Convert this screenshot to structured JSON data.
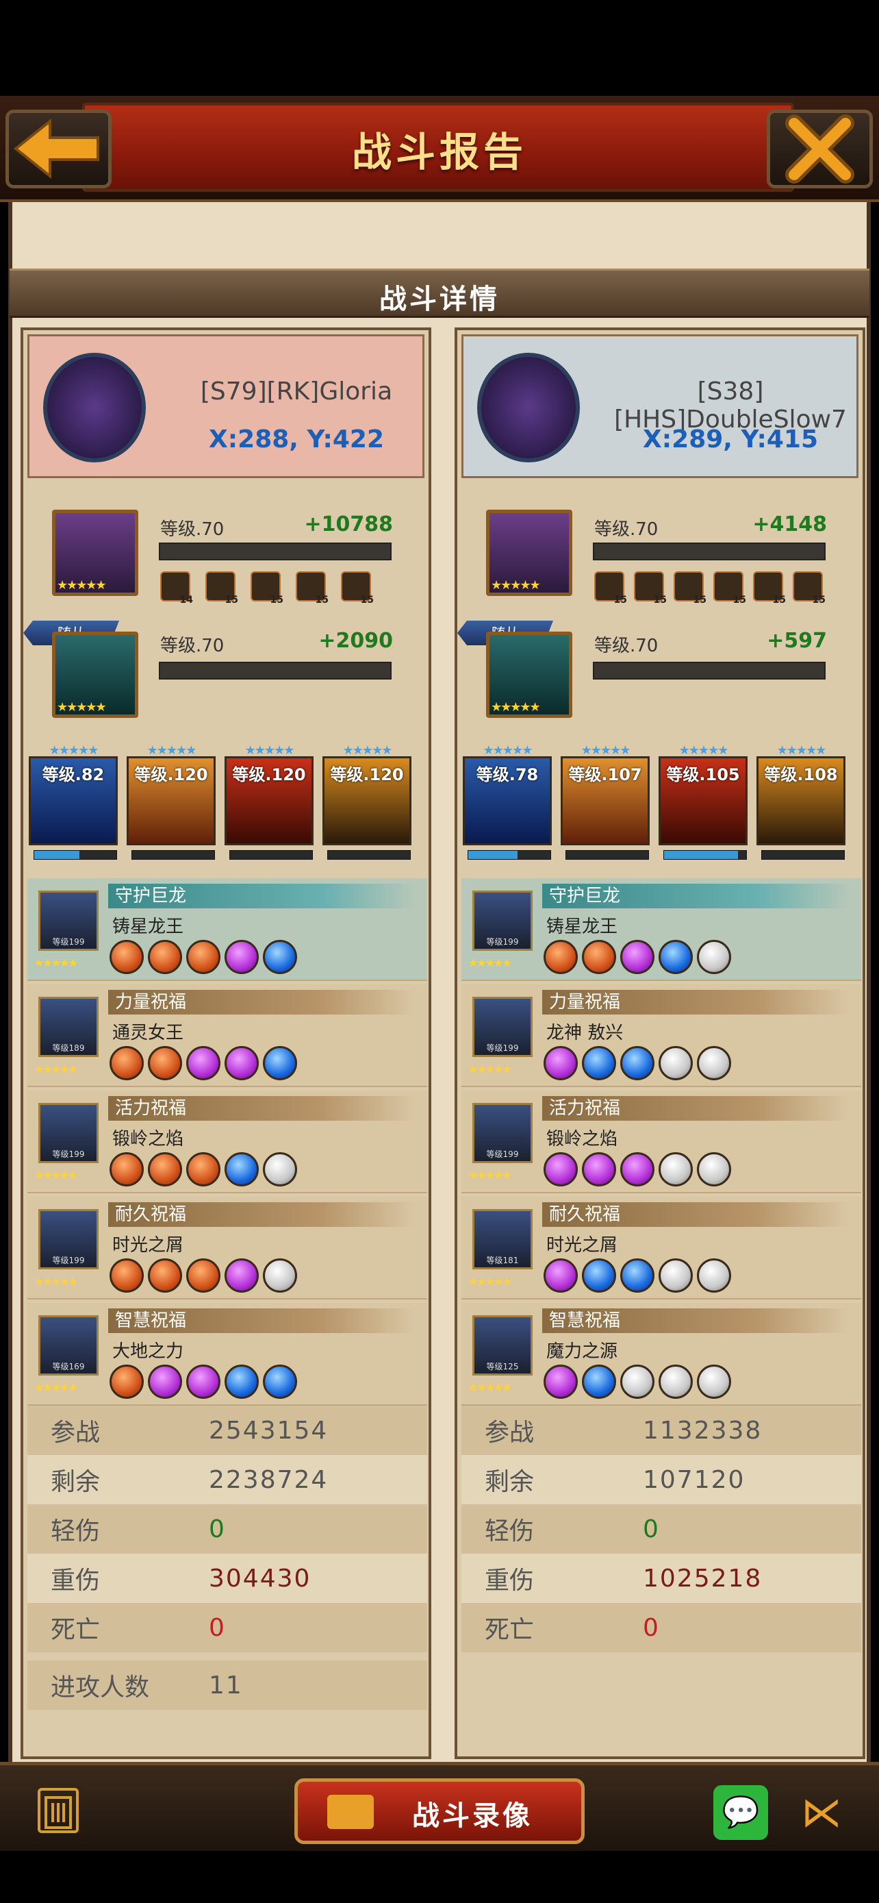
{
  "header": {
    "title": "战斗报告"
  },
  "section": {
    "title": "战斗详情"
  },
  "colors": {
    "left_card": "#e8b7a8",
    "right_card": "#ccd3d6",
    "green": "#1f7a1f",
    "blue": "#1b5fb8"
  },
  "players": [
    {
      "name": "[S79][RK]Gloria",
      "coords": "X:288, Y:422",
      "hero": {
        "level": "等级.70",
        "gain": "+10788",
        "gear": [
          "14",
          "15",
          "15",
          "15",
          "15"
        ]
      },
      "companion": {
        "tag": "随从",
        "level": "等级.70",
        "gain": "+2090"
      },
      "troops": [
        {
          "level": "等级.82",
          "exp_fill": 0.55
        },
        {
          "level": "等级.120",
          "exp_fill": 0.0
        },
        {
          "level": "等级.120",
          "exp_fill": 0.0
        },
        {
          "level": "等级.120",
          "exp_fill": 0.0
        }
      ],
      "dragons": [
        {
          "category": "守护巨龙",
          "name": "铸星龙王",
          "dlevel": "等级199",
          "orbs": [
            "orange",
            "orange",
            "orange",
            "purple",
            "blue"
          ]
        },
        {
          "category": "力量祝福",
          "name": "通灵女王",
          "dlevel": "等级189",
          "orbs": [
            "orange",
            "orange",
            "purple",
            "purple",
            "blue"
          ]
        },
        {
          "category": "活力祝福",
          "name": "锻岭之焰",
          "dlevel": "等级199",
          "orbs": [
            "orange",
            "orange",
            "orange",
            "blue",
            "grey"
          ]
        },
        {
          "category": "耐久祝福",
          "name": "时光之屑",
          "dlevel": "等级199",
          "orbs": [
            "orange",
            "orange",
            "orange",
            "purple",
            "grey"
          ]
        },
        {
          "category": "智慧祝福",
          "name": "大地之力",
          "dlevel": "等级169",
          "orbs": [
            "orange",
            "purple",
            "purple",
            "blue",
            "blue"
          ]
        }
      ],
      "stats": [
        {
          "label": "参战",
          "value": "2543154",
          "color": "#555"
        },
        {
          "label": "剩余",
          "value": "2238724",
          "color": "#555"
        },
        {
          "label": "轻伤",
          "value": "0",
          "color": "#1f7a1f"
        },
        {
          "label": "重伤",
          "value": "304430",
          "color": "#7a1a1a"
        },
        {
          "label": "死亡",
          "value": "0",
          "color": "#c02020"
        }
      ],
      "attackers": {
        "label": "进攻人数",
        "value": "11"
      }
    },
    {
      "name": "[S38][HHS]DoubleSlow7",
      "coords": "X:289, Y:415",
      "hero": {
        "level": "等级.70",
        "gain": "+4148",
        "gear": [
          "15",
          "15",
          "15",
          "15",
          "15",
          "15"
        ]
      },
      "companion": {
        "tag": "随从",
        "level": "等级.70",
        "gain": "+597"
      },
      "troops": [
        {
          "level": "等级.78",
          "exp_fill": 0.6
        },
        {
          "level": "等级.107",
          "exp_fill": 0.0
        },
        {
          "level": "等级.105",
          "exp_fill": 0.9
        },
        {
          "level": "等级.108",
          "exp_fill": 0.0
        }
      ],
      "dragons": [
        {
          "category": "守护巨龙",
          "name": "铸星龙王",
          "dlevel": "等级199",
          "orbs": [
            "orange",
            "orange",
            "purple",
            "blue",
            "grey"
          ]
        },
        {
          "category": "力量祝福",
          "name": "龙神 敖兴",
          "dlevel": "等级199",
          "orbs": [
            "purple",
            "blue",
            "blue",
            "grey",
            "grey"
          ]
        },
        {
          "category": "活力祝福",
          "name": "锻岭之焰",
          "dlevel": "等级199",
          "orbs": [
            "purple",
            "purple",
            "purple",
            "grey",
            "grey"
          ]
        },
        {
          "category": "耐久祝福",
          "name": "时光之屑",
          "dlevel": "等级181",
          "orbs": [
            "purple",
            "blue",
            "blue",
            "grey",
            "grey"
          ]
        },
        {
          "category": "智慧祝福",
          "name": "魔力之源",
          "dlevel": "等级125",
          "orbs": [
            "purple",
            "blue",
            "grey",
            "grey",
            "grey"
          ]
        }
      ],
      "stats": [
        {
          "label": "参战",
          "value": "1132338",
          "color": "#555"
        },
        {
          "label": "剩余",
          "value": "107120",
          "color": "#555"
        },
        {
          "label": "轻伤",
          "value": "0",
          "color": "#1f7a1f"
        },
        {
          "label": "重伤",
          "value": "1025218",
          "color": "#7a1a1a"
        },
        {
          "label": "死亡",
          "value": "0",
          "color": "#c02020"
        }
      ]
    }
  ],
  "footer": {
    "replay_label": "战斗录像",
    "trash_icon": "trash-icon",
    "wechat_icon": "wechat-icon",
    "share_icon": "share-icon"
  }
}
